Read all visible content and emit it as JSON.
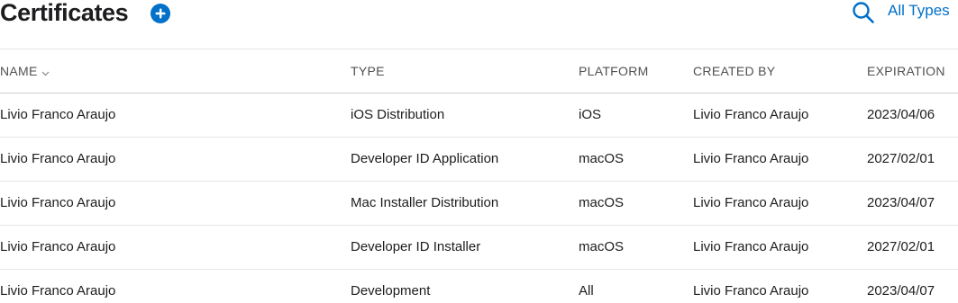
{
  "header": {
    "title": "Certificates",
    "filter_label": "All Types"
  },
  "icons": {
    "add": "plus-circle-icon",
    "search": "search-icon",
    "sort": "chevron-down-icon"
  },
  "colors": {
    "accent": "#0070c9",
    "text": "#1d1d1f",
    "header_text": "#515154"
  },
  "table": {
    "columns": [
      "NAME",
      "TYPE",
      "PLATFORM",
      "CREATED BY",
      "EXPIRATION"
    ],
    "rows": [
      [
        "Livio Franco Araujo",
        "iOS Distribution",
        "iOS",
        "Livio Franco Araujo",
        "2023/04/06"
      ],
      [
        "Livio Franco Araujo",
        "Developer ID Application",
        "macOS",
        "Livio Franco Araujo",
        "2027/02/01"
      ],
      [
        "Livio Franco Araujo",
        "Mac Installer Distribution",
        "macOS",
        "Livio Franco Araujo",
        "2023/04/07"
      ],
      [
        "Livio Franco Araujo",
        "Developer ID Installer",
        "macOS",
        "Livio Franco Araujo",
        "2027/02/01"
      ],
      [
        "Livio Franco Araujo",
        "Development",
        "All",
        "Livio Franco Araujo",
        "2023/04/07"
      ]
    ]
  }
}
